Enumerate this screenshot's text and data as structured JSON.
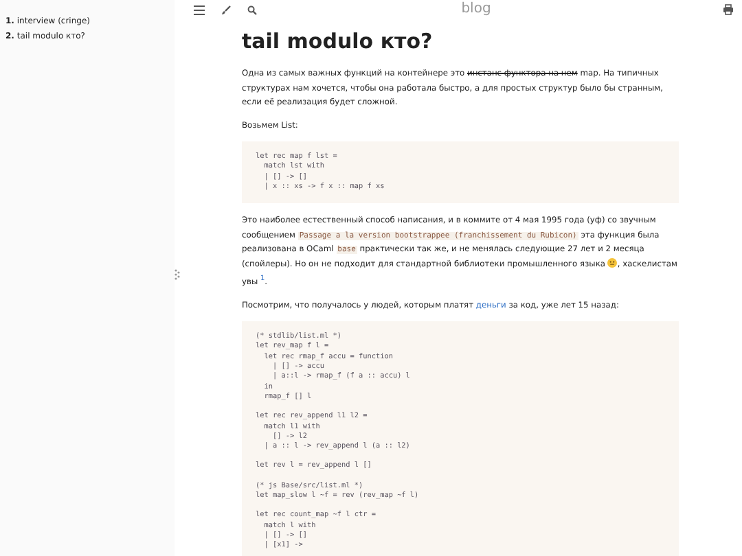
{
  "sidebar": {
    "items": [
      {
        "number": "1.",
        "label": "interview (cringe)"
      },
      {
        "number": "2.",
        "label": "tail modulo кто?"
      }
    ]
  },
  "toolbar": {
    "title": "blog"
  },
  "article": {
    "title": "tail modulo кто?",
    "blocks": [
      {
        "kind": "paragraph",
        "segments": [
          {
            "kind": "text",
            "text": "Одна из самых важных функций на контейнере это "
          },
          {
            "kind": "strike",
            "text": "инстанс функтора на нем"
          },
          {
            "kind": "text",
            "text": " map. На типичных структурах нам хочется, чтобы она работала быстро, а для простых структур было бы странным, если её реализация будет сложной."
          }
        ]
      },
      {
        "kind": "paragraph",
        "segments": [
          {
            "kind": "text",
            "text": "Возьмем List:"
          }
        ]
      },
      {
        "kind": "code",
        "groups": [
          [
            "let rec map f lst =",
            "  match lst with",
            "  | [] -> []",
            "  | x :: xs -> f x :: map f xs"
          ]
        ]
      },
      {
        "kind": "paragraph",
        "segments": [
          {
            "kind": "text",
            "text": "Это наиболее естественный способ написания, и в коммите от 4 мая 1995 года (уф) со звучным сообщением "
          },
          {
            "kind": "code",
            "text": "Passage a la version bootstrappee (franchissement du Rubicon)"
          },
          {
            "kind": "text",
            "text": " эта функция была реализована в OCaml "
          },
          {
            "kind": "code",
            "text": "base"
          },
          {
            "kind": "text",
            "text": " практически так же, и не менялась следующие 27 лет и 2 месяца (спойлеры). Но он не подходит для стандартной библиотеки промышленного языка "
          },
          {
            "kind": "smiley"
          },
          {
            "kind": "text",
            "text": ", хаскелистам увы "
          },
          {
            "kind": "footnote",
            "text": "1"
          },
          {
            "kind": "text",
            "text": "."
          }
        ]
      },
      {
        "kind": "paragraph",
        "segments": [
          {
            "kind": "text",
            "text": "Посмотрим, что получалось у людей, которым платят "
          },
          {
            "kind": "link",
            "text": "деньги"
          },
          {
            "kind": "text",
            "text": " за код, уже лет 15 назад:"
          }
        ]
      },
      {
        "kind": "code",
        "groups": [
          [
            "(* stdlib/list.ml *)",
            "let rev_map f l =",
            "  let rec rmap_f accu = function",
            "    | [] -> accu",
            "    | a::l -> rmap_f (f a :: accu) l",
            "  in",
            "  rmap_f [] l"
          ],
          [
            "let rec rev_append l1 l2 =",
            "  match l1 with",
            "    [] -> l2",
            "  | a :: l -> rev_append l (a :: l2)"
          ],
          [
            "let rev l = rev_append l []"
          ],
          [
            "(* js Base/src/list.ml *)",
            "let map_slow l ~f = rev (rev_map ~f l)"
          ],
          [
            "let rec count_map ~f l ctr =",
            "  match l with",
            "  | [] -> []",
            "  | [x1] ->"
          ]
        ]
      }
    ]
  }
}
